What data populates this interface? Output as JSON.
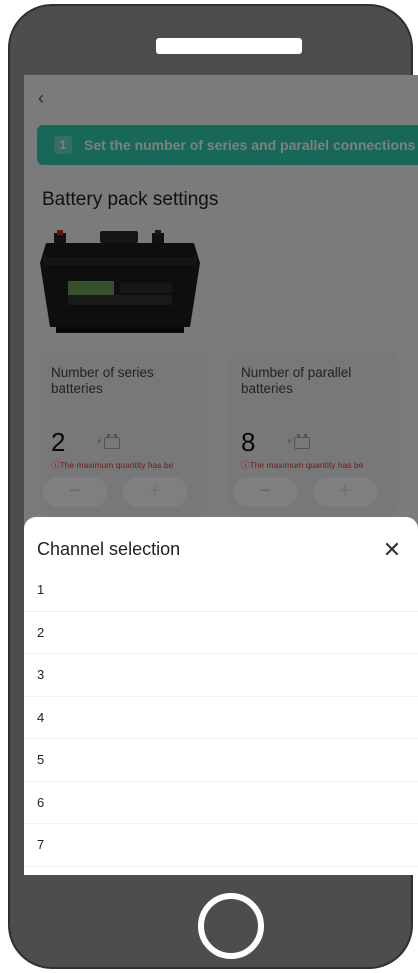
{
  "app": {
    "back_glyph": "‹",
    "step": {
      "number": "1",
      "text": "Set the number of series and parallel connections"
    },
    "section_title": "Battery pack settings",
    "series": {
      "label": "Number of series batteries",
      "value": "2",
      "unit": "*",
      "warning": "ⓘThe maximum quantity has be",
      "minus": "−",
      "plus": "+"
    },
    "parallel": {
      "label": "Number of parallel batteries",
      "value": "8",
      "unit": "*",
      "warning": "ⓘThe maximum quantity has be",
      "minus": "−",
      "plus": "+"
    }
  },
  "sheet": {
    "title": "Channel selection",
    "close_glyph": "✕",
    "options": [
      "1",
      "2",
      "3",
      "4",
      "5",
      "6",
      "7"
    ]
  },
  "colors": {
    "accent": "#2ed0b3",
    "warning": "#e53935",
    "frame": "#4d4d4d"
  }
}
